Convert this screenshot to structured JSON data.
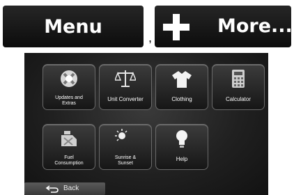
{
  "top_buttons": {
    "menu_label": "Menu",
    "more_label": "More...",
    "separator": ","
  },
  "grid": {
    "tiles": [
      {
        "label": "Updates and\nExtras",
        "icon": "updates-extras-icon"
      },
      {
        "label": "Unit Converter",
        "icon": "scales-icon"
      },
      {
        "label": "Clothing",
        "icon": "tshirt-icon"
      },
      {
        "label": "Calculator",
        "icon": "calculator-icon"
      },
      {
        "label": "Fuel\nConsumption",
        "icon": "fuel-can-icon"
      },
      {
        "label": "Sunrise &\nSunset",
        "icon": "sun-moon-icon"
      },
      {
        "label": "Help",
        "icon": "lightbulb-icon"
      }
    ]
  },
  "back_label": "Back"
}
